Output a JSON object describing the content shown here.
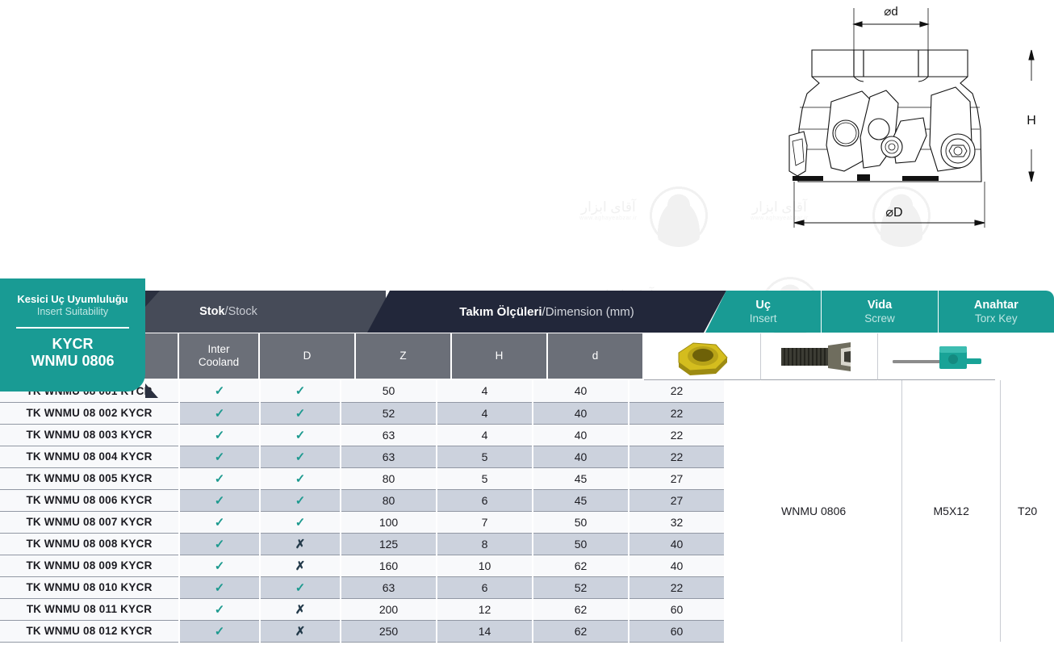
{
  "drawing": {
    "label_top": "⌀d",
    "label_bottom": "⌀D",
    "label_side": "H",
    "name": "face-mill-cutter-technical-drawing"
  },
  "watermark": {
    "text": "آقای ابزار",
    "sub": "www.aghayeabzar.ir"
  },
  "header": {
    "insert_suitability": {
      "title_tr": "Kesici Uç Uyumluluğu",
      "title_en": "Insert Suitability",
      "code_line1": "KYCR",
      "code_line2": "WNMU 0806"
    },
    "stock": {
      "tr": "Stok",
      "sep": " / ",
      "en": "Stock"
    },
    "dimension": {
      "tr": "Takım Ölçüleri",
      "sep": " / ",
      "en": "Dimension (mm)"
    },
    "right_groups": [
      {
        "tr": "Uç",
        "en": "Insert",
        "icon": "carbide-insert-icon"
      },
      {
        "tr": "Vida",
        "en": "Screw",
        "icon": "torx-screw-icon"
      },
      {
        "tr": "Anahtar",
        "en": "Torx Key",
        "icon": "torx-key-icon"
      }
    ],
    "subcolumns": [
      {
        "label": "",
        "name": "stock-available-column"
      },
      {
        "label": "Inter\nCooland",
        "line1": "Inter",
        "line2": "Cooland",
        "name": "inter-coolant-column"
      },
      {
        "label": "D",
        "name": "diameter-column"
      },
      {
        "label": "Z",
        "name": "teeth-count-column"
      },
      {
        "label": "H",
        "name": "height-column"
      },
      {
        "label": "d",
        "name": "bore-column"
      }
    ]
  },
  "colors": {
    "teal": "#199b94",
    "dark_header": "#464b58",
    "darker_header": "#22273a",
    "subheader_gray": "#6b6f78",
    "row_odd": "#ccd2dd",
    "row_even": "#f8f9fb",
    "check": "#1d9a8f",
    "cross": "#233a4a"
  },
  "glyphs": {
    "check": "✓",
    "cross": "✗"
  },
  "merged": {
    "insert": "WNMU 0806",
    "screw": "M5X12",
    "key": "T20"
  },
  "rows": [
    {
      "code": "TK WNMU 08 001 KYCR",
      "stock": "✓",
      "coolant": "✓",
      "D": "50",
      "Z": "4",
      "H": "40",
      "d": "22"
    },
    {
      "code": "TK WNMU 08 002 KYCR",
      "stock": "✓",
      "coolant": "✓",
      "D": "52",
      "Z": "4",
      "H": "40",
      "d": "22"
    },
    {
      "code": "TK WNMU 08 003 KYCR",
      "stock": "✓",
      "coolant": "✓",
      "D": "63",
      "Z": "4",
      "H": "40",
      "d": "22"
    },
    {
      "code": "TK WNMU 08 004 KYCR",
      "stock": "✓",
      "coolant": "✓",
      "D": "63",
      "Z": "5",
      "H": "40",
      "d": "22"
    },
    {
      "code": "TK WNMU 08 005 KYCR",
      "stock": "✓",
      "coolant": "✓",
      "D": "80",
      "Z": "5",
      "H": "45",
      "d": "27"
    },
    {
      "code": "TK WNMU 08 006 KYCR",
      "stock": "✓",
      "coolant": "✓",
      "D": "80",
      "Z": "6",
      "H": "45",
      "d": "27"
    },
    {
      "code": "TK WNMU 08 007 KYCR",
      "stock": "✓",
      "coolant": "✓",
      "D": "100",
      "Z": "7",
      "H": "50",
      "d": "32"
    },
    {
      "code": "TK WNMU 08 008 KYCR",
      "stock": "✓",
      "coolant": "✗",
      "D": "125",
      "Z": "8",
      "H": "50",
      "d": "40"
    },
    {
      "code": "TK WNMU 08 009 KYCR",
      "stock": "✓",
      "coolant": "✗",
      "D": "160",
      "Z": "10",
      "H": "62",
      "d": "40"
    },
    {
      "code": "TK WNMU 08 010 KYCR",
      "stock": "✓",
      "coolant": "✓",
      "D": "63",
      "Z": "6",
      "H": "52",
      "d": "22"
    },
    {
      "code": "TK WNMU 08 011 KYCR",
      "stock": "✓",
      "coolant": "✗",
      "D": "200",
      "Z": "12",
      "H": "62",
      "d": "60"
    },
    {
      "code": "TK WNMU 08 012 KYCR",
      "stock": "✓",
      "coolant": "✗",
      "D": "250",
      "Z": "14",
      "H": "62",
      "d": "60"
    }
  ]
}
